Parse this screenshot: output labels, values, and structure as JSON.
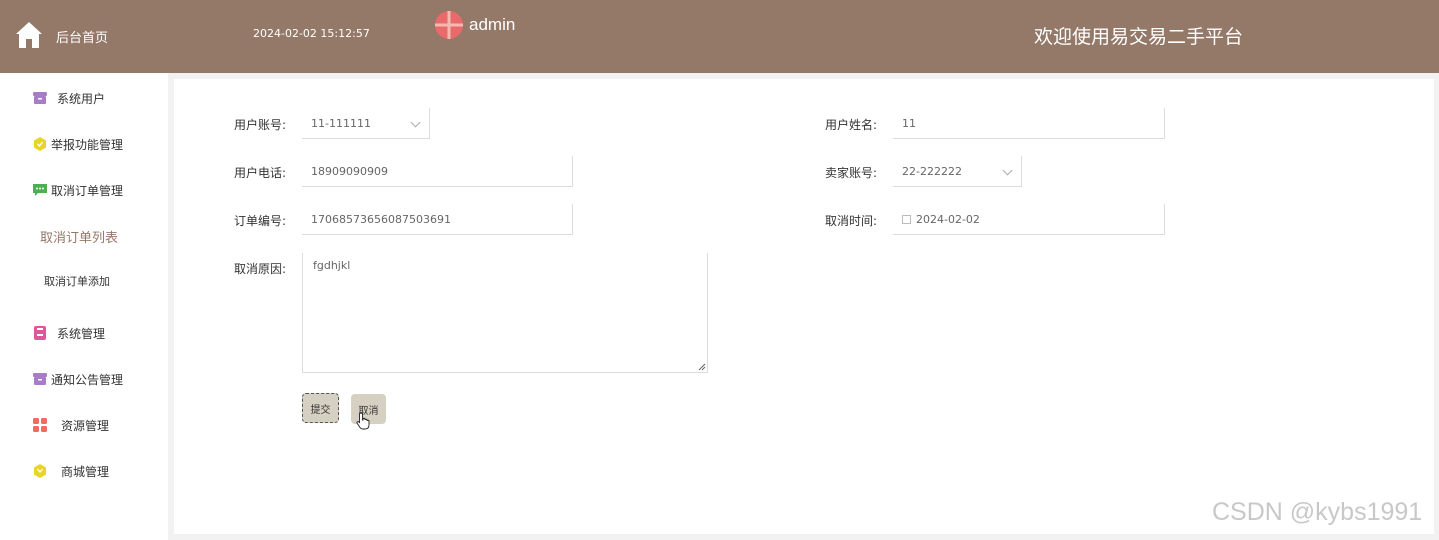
{
  "header": {
    "home_label": "后台首页",
    "datetime": "2024-02-02 15:12:57",
    "username": "admin",
    "welcome": "欢迎使用易交易二手平台",
    "bg_color": "#947868"
  },
  "sidebar": {
    "items": [
      {
        "label": "系统用户",
        "icon": "archive-icon",
        "color": "#a97cc9"
      },
      {
        "label": "举报功能管理",
        "icon": "hexagon-icon",
        "color": "#e8d52a"
      },
      {
        "label": "取消订单管理",
        "icon": "message-icon",
        "color": "#4caf50"
      },
      {
        "label": "系统管理",
        "icon": "box-icon",
        "color": "#e0569b"
      },
      {
        "label": "通知公告管理",
        "icon": "archive-icon",
        "color": "#a97cc9"
      },
      {
        "label": "资源管理",
        "icon": "grid-icon",
        "color": "#ef6b5c"
      },
      {
        "label": "商城管理",
        "icon": "hexagon-icon",
        "color": "#e8d52a"
      }
    ],
    "sub_items": [
      {
        "label": "取消订单列表",
        "active": true
      },
      {
        "label": "取消订单添加",
        "active": false
      }
    ],
    "active_color": "#947868"
  },
  "form": {
    "user_account": {
      "label": "用户账号:",
      "value": "11-111111"
    },
    "user_name": {
      "label": "用户姓名:",
      "value": "11"
    },
    "user_phone": {
      "label": "用户电话:",
      "value": "18909090909"
    },
    "seller_account": {
      "label": "卖家账号:",
      "value": "22-222222"
    },
    "order_no": {
      "label": "订单编号:",
      "value": "17068573656087503691"
    },
    "cancel_time": {
      "label": "取消时间:",
      "value": "2024-02-02"
    },
    "cancel_reason": {
      "label": "取消原因:",
      "value": "fgdhjkl"
    }
  },
  "buttons": {
    "submit": "提交",
    "cancel": "取消"
  },
  "watermark": "CSDN @kybs1991"
}
